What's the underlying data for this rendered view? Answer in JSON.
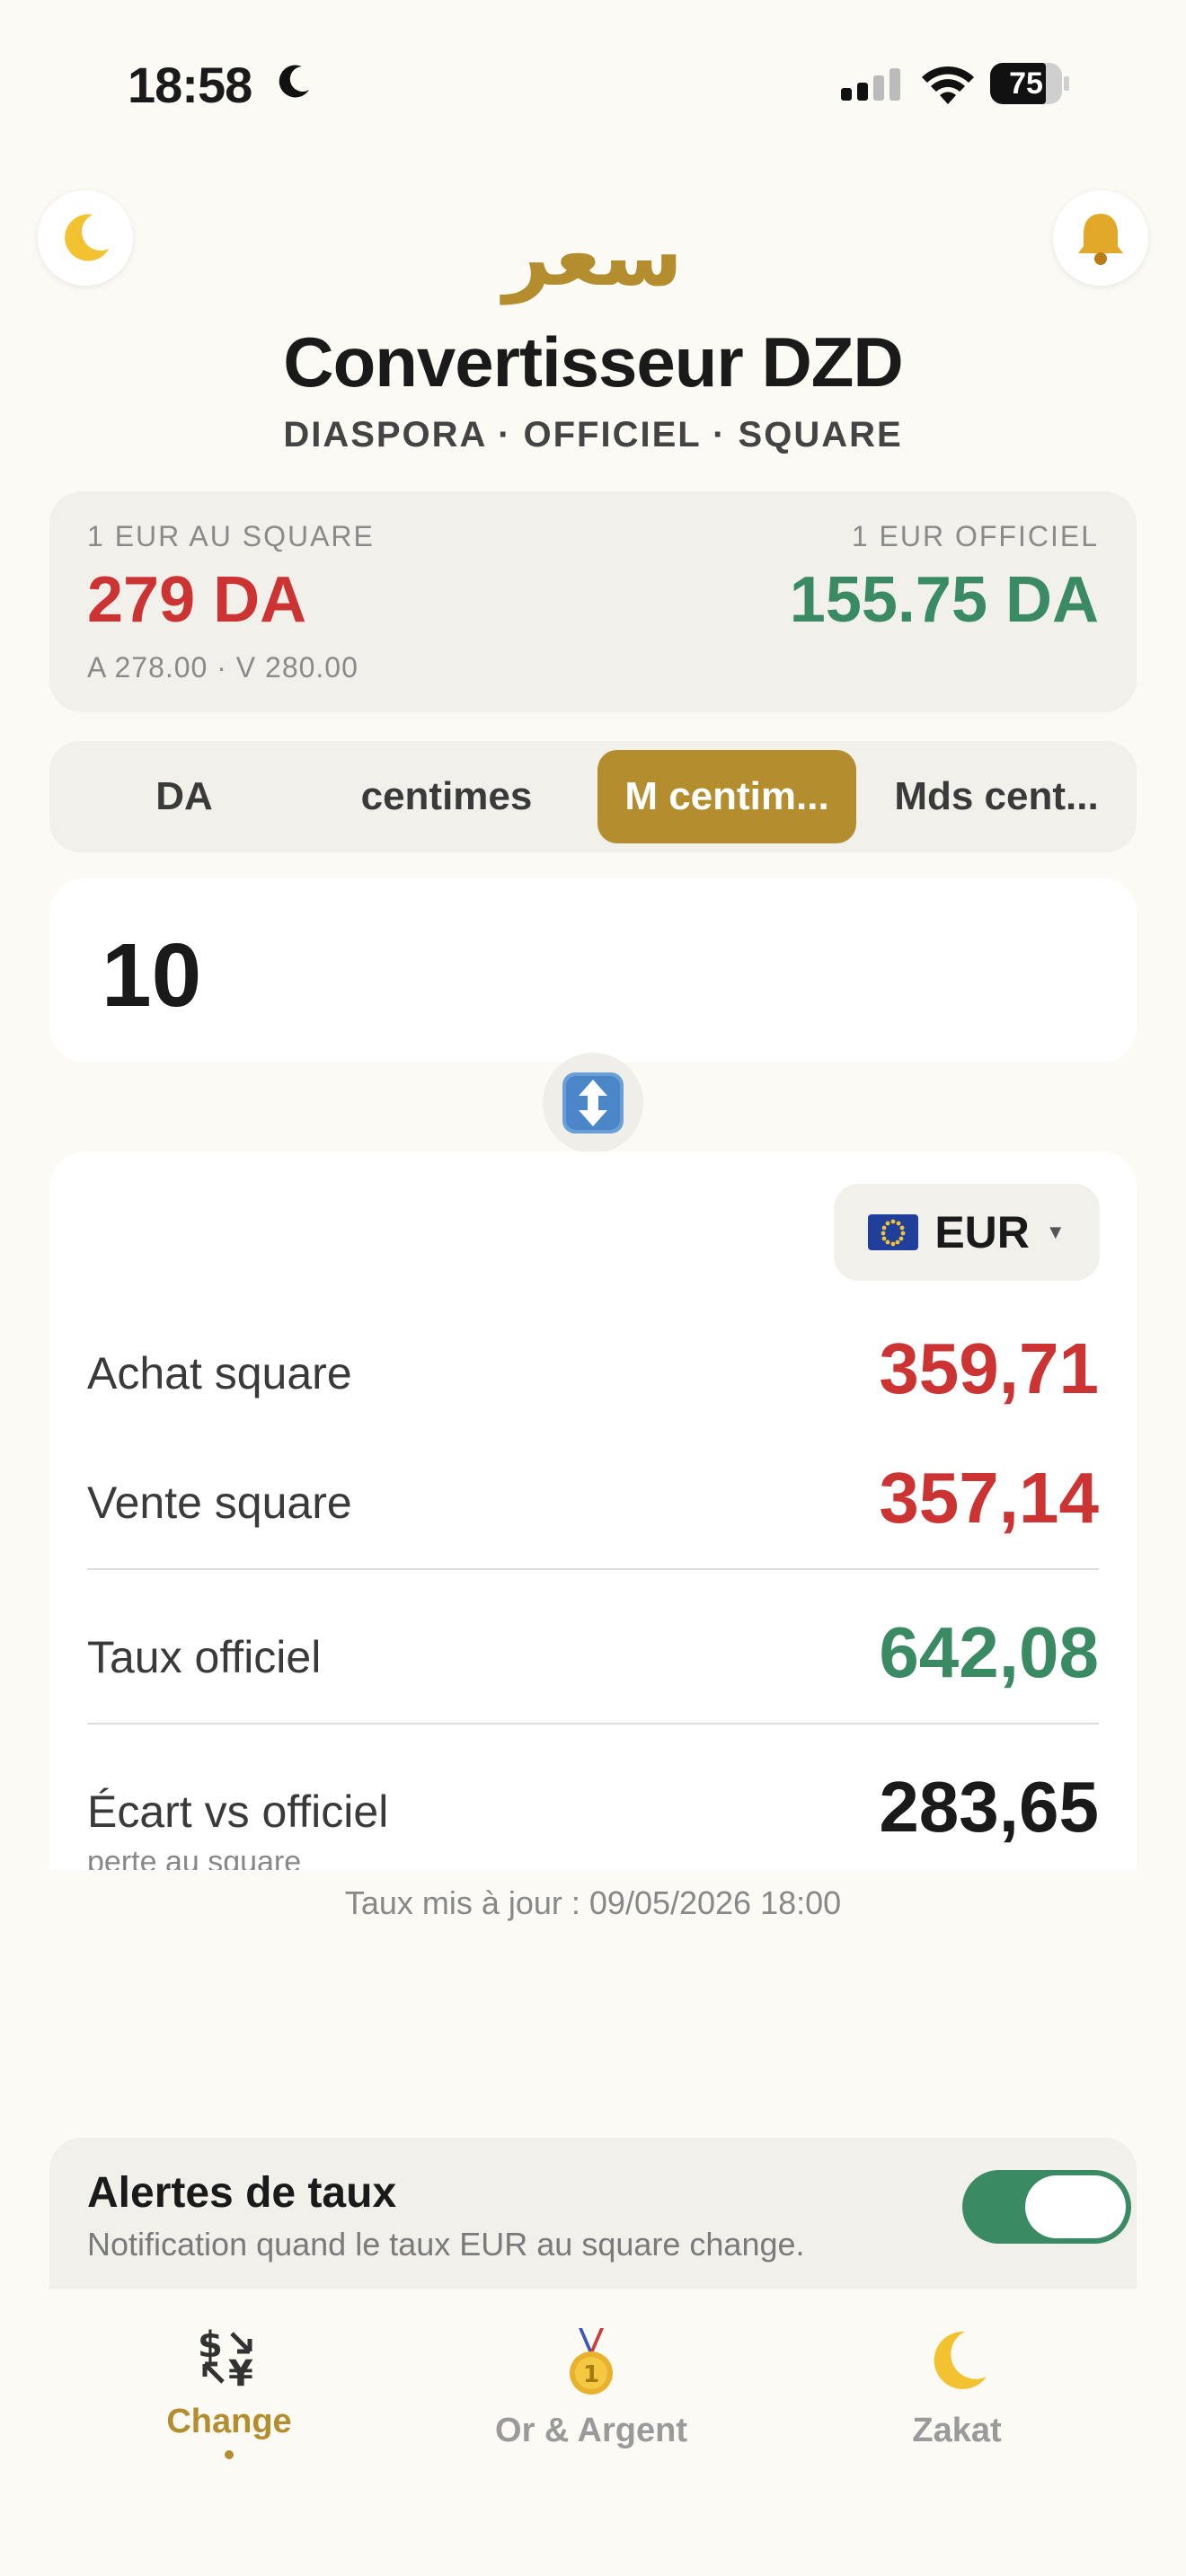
{
  "status_bar": {
    "time": "18:58",
    "battery": "75"
  },
  "header": {
    "arabic_logo": "سعر",
    "title": "Convertisseur DZD",
    "subtitle": "DIASPORA · OFFICIEL · SQUARE"
  },
  "rates": {
    "square_label": "1 EUR AU SQUARE",
    "square_value": "279 DA",
    "square_detail": "A 278.00 · V 280.00",
    "official_label": "1 EUR OFFICIEL",
    "official_value": "155.75 DA"
  },
  "units": {
    "tabs": [
      {
        "label": "DA"
      },
      {
        "label": "centimes"
      },
      {
        "label": "M centim..."
      },
      {
        "label": "Mds cent..."
      }
    ],
    "active_index": 2
  },
  "input": {
    "value": "10"
  },
  "currency": {
    "flag": "🇪🇺",
    "code": "EUR"
  },
  "results": [
    {
      "label": "Achat square",
      "value": "359,71",
      "color": "#cc3333"
    },
    {
      "label": "Vente square",
      "value": "357,14",
      "color": "#cc3333"
    },
    {
      "label": "Taux officiel",
      "value": "642,08",
      "color": "#3a8a63"
    },
    {
      "label": "Écart vs officiel",
      "value": "283,65",
      "color": "#1a1a1a",
      "sublabel": "perte au square"
    }
  ],
  "updated_text": "Taux mis à jour : 09/05/2026 18:00",
  "alerts": {
    "title": "Alertes de taux",
    "subtitle": "Notification quand le taux EUR au square change.",
    "enabled": true
  },
  "tabbar": [
    {
      "label": "Change",
      "icon": "currency-exchange-icon",
      "active": true
    },
    {
      "label": "Or & Argent",
      "icon": "medal-icon",
      "active": false
    },
    {
      "label": "Zakat",
      "icon": "crescent-moon-icon",
      "active": false
    }
  ],
  "colors": {
    "accent": "#b48d2e",
    "red": "#cc3333",
    "green": "#3a8a63"
  }
}
